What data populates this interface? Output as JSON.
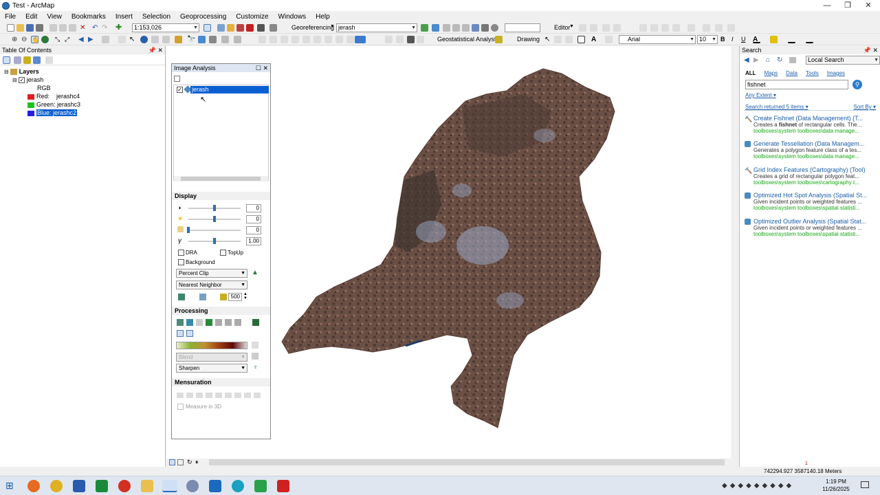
{
  "window": {
    "title": "Test - ArcMap"
  },
  "menu": [
    "File",
    "Edit",
    "View",
    "Bookmarks",
    "Insert",
    "Selection",
    "Geoprocessing",
    "Customize",
    "Windows",
    "Help"
  ],
  "toolbar": {
    "scale": "1:153,026",
    "georef_label": "Georeferencing",
    "georef_layer": "jerash",
    "editor_label": "Editor",
    "geostat_label": "Geostatistical Analyst",
    "drawing_label": "Drawing",
    "font": "Arial",
    "font_size": "10",
    "bold": "B",
    "italic": "I",
    "underline": "U"
  },
  "toc": {
    "title": "Table Of Contents",
    "layers_root": "Layers",
    "layer_name": "jerash",
    "rgb_label": "RGB",
    "bands": [
      {
        "label": "Red:",
        "value": "jerashc4",
        "color": "#e02020"
      },
      {
        "label": "Green:",
        "value": "jerashc3",
        "color": "#20c020"
      },
      {
        "label": "Blue:",
        "value": "jerashc2",
        "color": "#2020e0"
      }
    ]
  },
  "image_analysis": {
    "title": "Image Analysis",
    "layer_item": "jerash",
    "display_title": "Display",
    "sliders": [
      {
        "name": "contrast",
        "value": "0",
        "level": 0.5
      },
      {
        "name": "brightness",
        "value": "0",
        "level": 0.5
      },
      {
        "name": "transparency",
        "value": "0",
        "level": 0.0
      },
      {
        "name": "gamma",
        "value": "1.00",
        "level": 0.5
      }
    ],
    "gamma_symbol": "γ",
    "dra_label": "DRA",
    "topup_label": "TopUp",
    "background_label": "Background",
    "stretch": "Percent Clip",
    "resampling": "Nearest Neighbor",
    "zoom_value": "500",
    "processing_title": "Processing",
    "blend": "Blend",
    "sharpen": "Sharpen",
    "mensuration_title": "Mensuration",
    "measure3d": "Measure in 3D"
  },
  "search": {
    "title": "Search",
    "scope": "Local Search",
    "tabs": [
      "ALL",
      "Maps",
      "Data",
      "Tools",
      "Images"
    ],
    "query": "fishnet",
    "extent": "Any Extent",
    "returned": "Search returned 5 items",
    "sort": "Sort By",
    "results": [
      {
        "title": "Create Fishnet (Data Management) (T...",
        "desc_pre": "Creates a ",
        "desc_bold": "fishnet",
        "desc_post": " of rectangular cells. The...",
        "path": "toolboxes\\system toolboxes\\data manage..."
      },
      {
        "title": "Generate Tessellation (Data Managem...",
        "desc_pre": "Generates a polygon feature class of a tes...",
        "desc_bold": "",
        "desc_post": "",
        "path": "toolboxes\\system toolboxes\\data manage..."
      },
      {
        "title": "Grid Index Features (Cartography) (Tool)",
        "desc_pre": "Creates a grid of rectangular polygon feat...",
        "desc_bold": "",
        "desc_post": "",
        "path": "toolboxes\\system toolboxes\\cartography t..."
      },
      {
        "title": "Optimized Hot Spot Analysis (Spatial St...",
        "desc_pre": "Given incident points or weighted features ...",
        "desc_bold": "",
        "desc_post": "",
        "path": "toolboxes\\system toolboxes\\spatial statisti..."
      },
      {
        "title": "Optimized Outlier Analysis (Spatial Stat...",
        "desc_pre": "Given incident points or weighted features ...",
        "desc_bold": "",
        "desc_post": "",
        "path": "toolboxes\\system toolboxes\\spatial statisti..."
      }
    ]
  },
  "status": {
    "coords": "742294.927  3587140.18 Meters",
    "page_marker": "1"
  },
  "taskbar": {
    "time": "1:19 PM",
    "date": "11/26/2025"
  }
}
